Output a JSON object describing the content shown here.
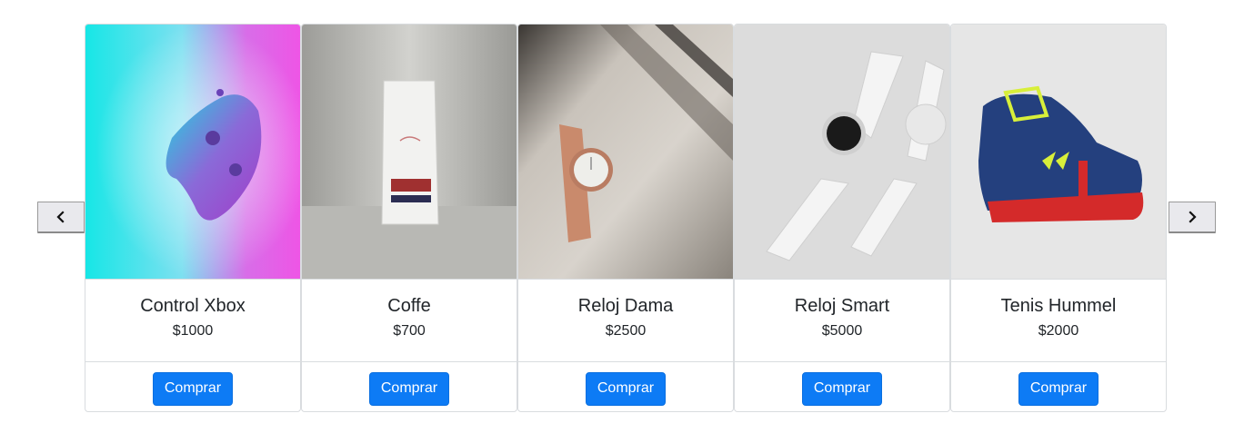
{
  "carousel": {
    "prev_icon": "chevron-left-icon",
    "next_icon": "chevron-right-icon",
    "products": [
      {
        "name": "Control Xbox",
        "price": "$1000",
        "button": "Comprar",
        "image": "xbox-controller-image"
      },
      {
        "name": "Coffe",
        "price": "$700",
        "button": "Comprar",
        "image": "coffee-bag-image"
      },
      {
        "name": "Reloj Dama",
        "price": "$2500",
        "button": "Comprar",
        "image": "womens-watch-image"
      },
      {
        "name": "Reloj Smart",
        "price": "$5000",
        "button": "Comprar",
        "image": "smartwatch-image"
      },
      {
        "name": "Tenis Hummel",
        "price": "$2000",
        "button": "Comprar",
        "image": "hummel-sneaker-image"
      }
    ]
  },
  "colors": {
    "primary_button": "#0d7bf5",
    "card_border": "#d9dcdf"
  }
}
